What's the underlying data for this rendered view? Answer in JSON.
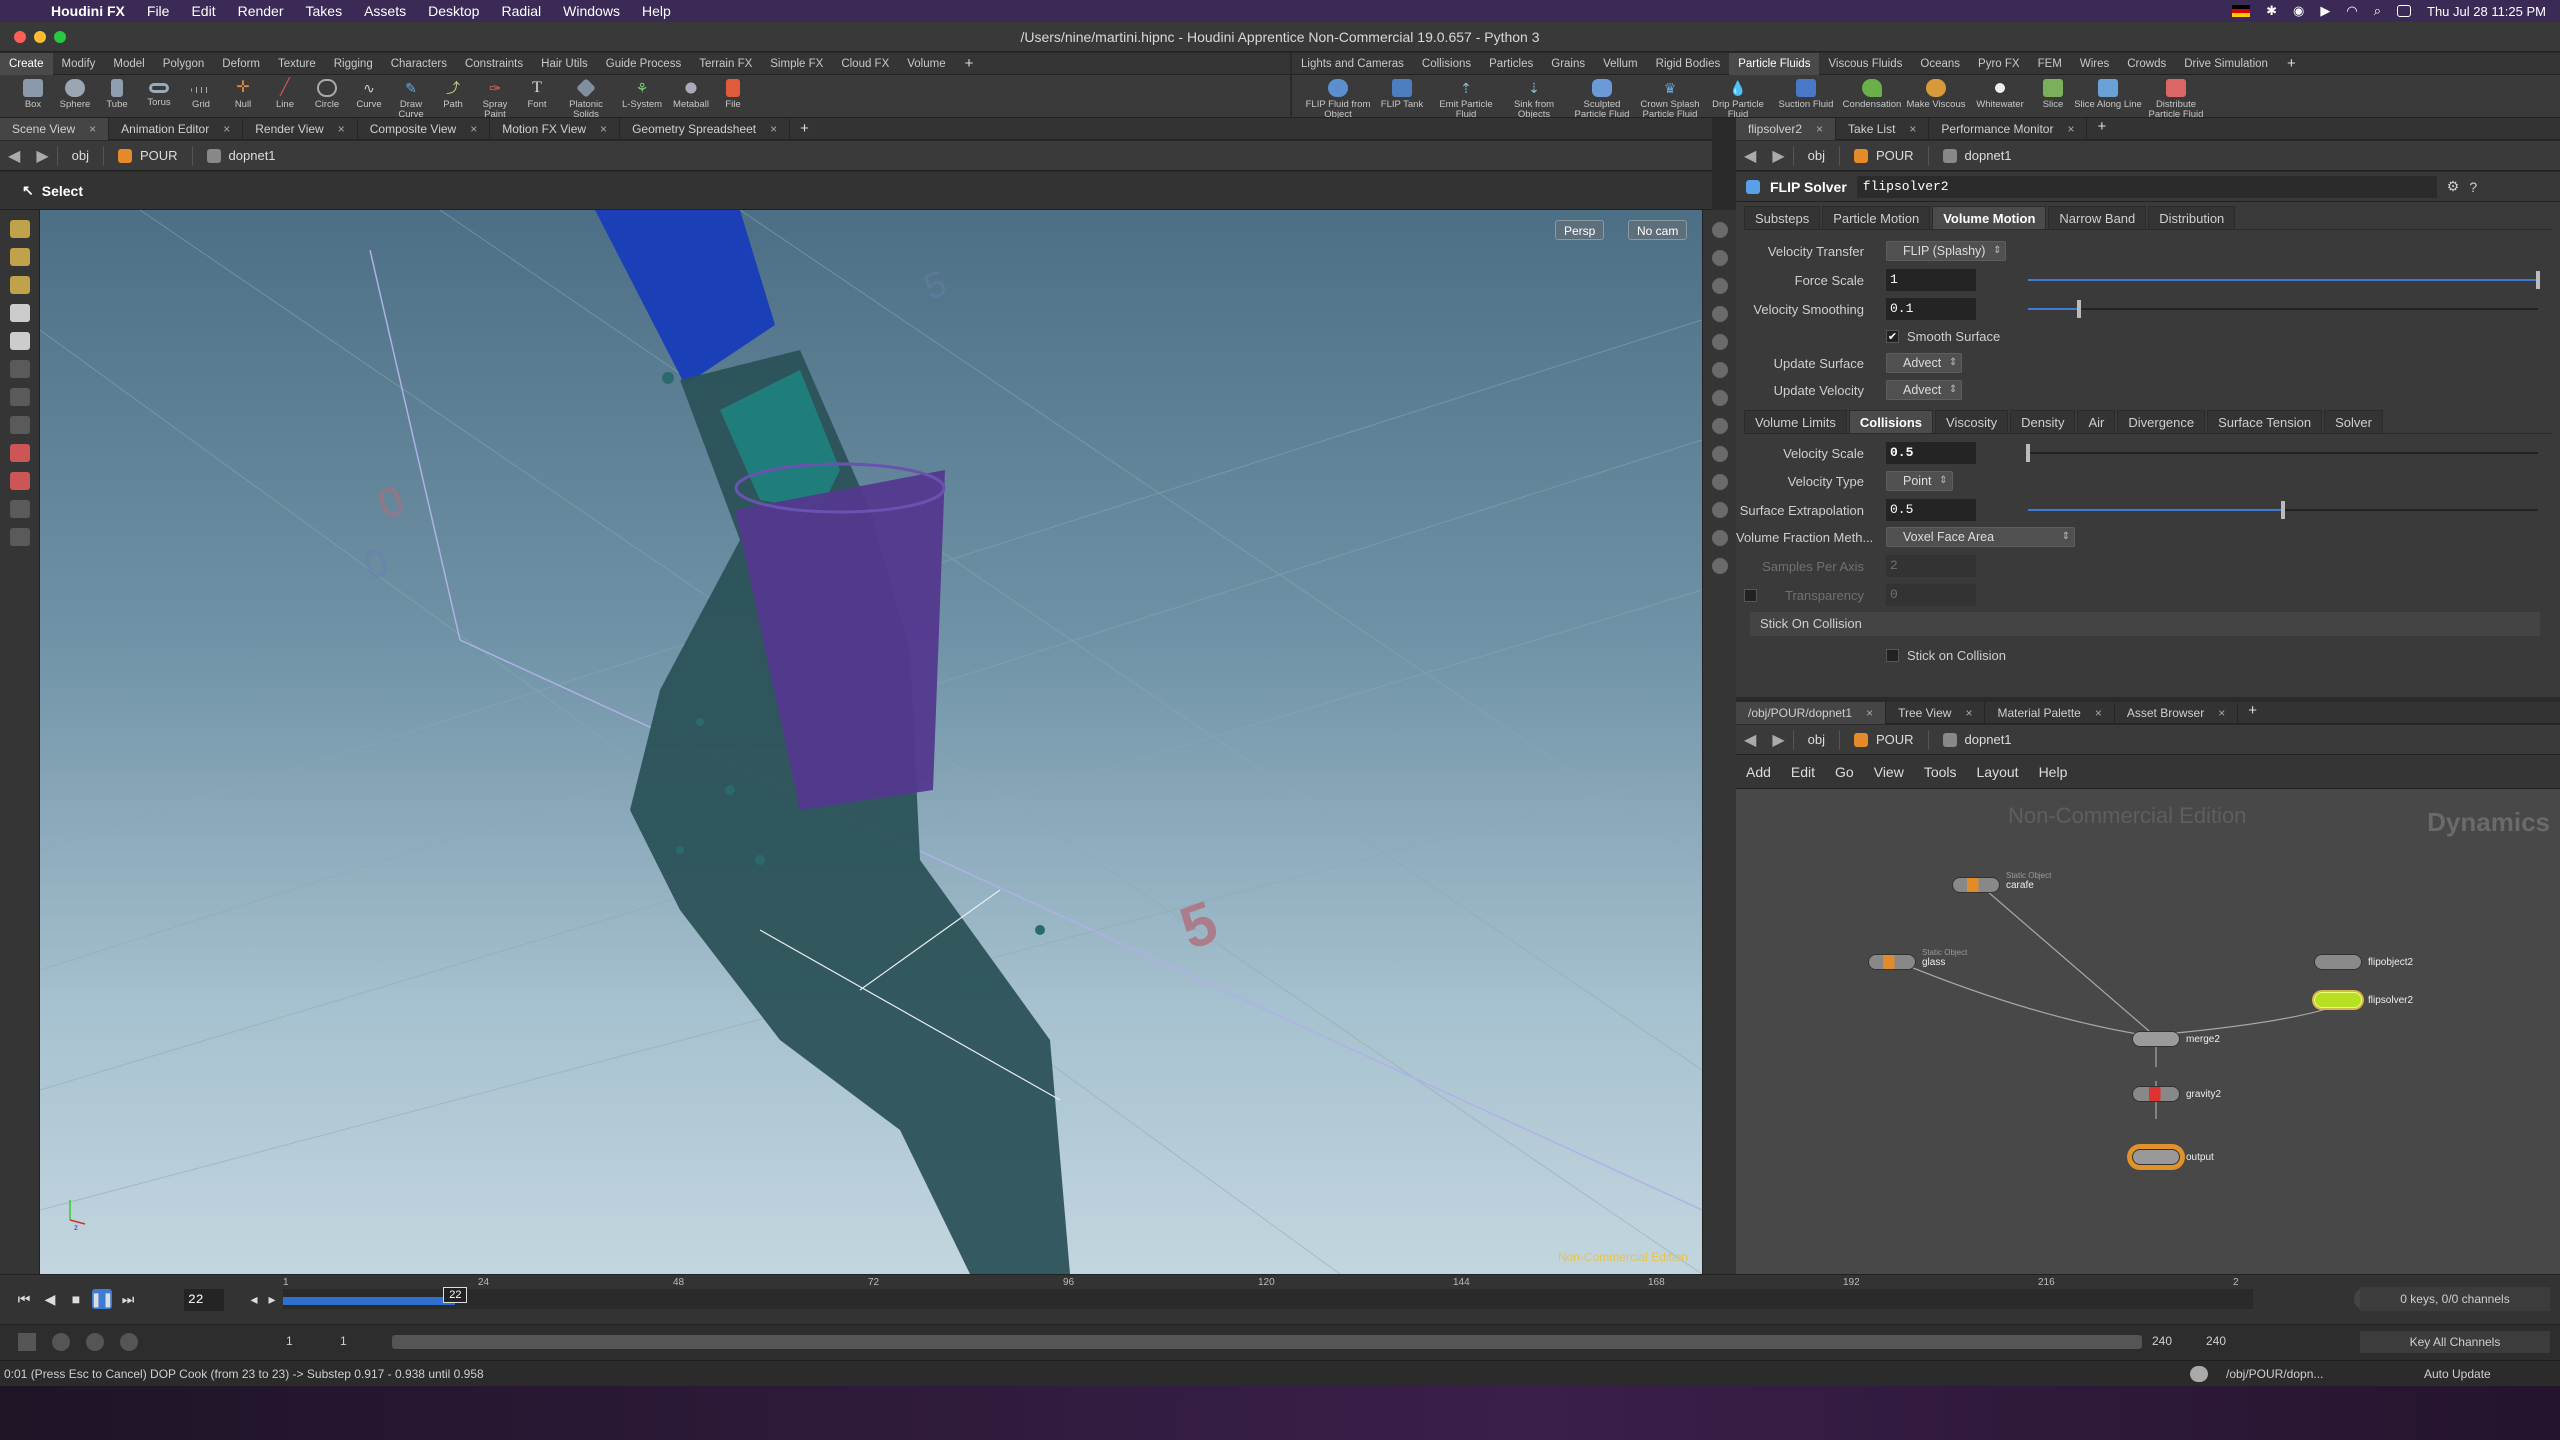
{
  "menubar": {
    "app": "Houdini FX",
    "items": [
      "File",
      "Edit",
      "Render",
      "Takes",
      "Assets",
      "Desktop",
      "Radial",
      "Windows",
      "Help"
    ],
    "clock": "Thu Jul 28  11:25 PM"
  },
  "window": {
    "title": "/Users/nine/martini.hipnc - Houdini Apprentice Non-Commercial 19.0.657 - Python 3"
  },
  "shelf_left": {
    "tabs": [
      "Create",
      "Modify",
      "Model",
      "Polygon",
      "Deform",
      "Texture",
      "Rigging",
      "Characters",
      "Constraints",
      "Hair Utils",
      "Guide Process",
      "Terrain FX",
      "Simple FX",
      "Cloud FX",
      "Volume"
    ],
    "tools": [
      "Box",
      "Sphere",
      "Tube",
      "Torus",
      "Grid",
      "Null",
      "Line",
      "Circle",
      "Curve",
      "Draw Curve",
      "Path",
      "Spray Paint",
      "Font",
      "Platonic Solids",
      "L-System",
      "Metaball",
      "File"
    ]
  },
  "shelf_right": {
    "tabs": [
      "Lights and Cameras",
      "Collisions",
      "Particles",
      "Grains",
      "Vellum",
      "Rigid Bodies",
      "Particle Fluids",
      "Viscous Fluids",
      "Oceans",
      "Pyro FX",
      "FEM",
      "Wires",
      "Crowds",
      "Drive Simulation"
    ],
    "tools": [
      "FLIP Fluid from Object",
      "FLIP Tank",
      "Emit Particle Fluid",
      "Sink from Objects",
      "Sculpted Particle Fluid",
      "Crown Splash Particle Fluid",
      "Drip Particle Fluid",
      "Suction Fluid",
      "Condensation",
      "Make Viscous",
      "Whitewater",
      "Slice",
      "Slice Along Line",
      "Distribute Particle Fluid"
    ]
  },
  "left_panel": {
    "tabs": [
      "Scene View",
      "Animation Editor",
      "Render View",
      "Composite View",
      "Motion FX View",
      "Geometry Spreadsheet"
    ],
    "path": [
      "obj",
      "POUR",
      "dopnet1"
    ],
    "mode": "Select",
    "persp": "Persp",
    "cam": "No cam",
    "watermark": "Non-Commercial Edition",
    "floor_labels": [
      "0",
      "5",
      "5"
    ]
  },
  "right_top": {
    "tabs": [
      "flipsolver2",
      "Take List",
      "Performance Monitor"
    ],
    "path": [
      "obj",
      "POUR",
      "dopnet1"
    ],
    "node_type": "FLIP Solver",
    "node_name": "flipsolver2",
    "tabs1": [
      "Substeps",
      "Particle Motion",
      "Volume Motion",
      "Narrow Band",
      "Distribution"
    ],
    "velocity_transfer": {
      "label": "Velocity Transfer",
      "value": "FLIP (Splashy)"
    },
    "force_scale": {
      "label": "Force Scale",
      "value": "1",
      "fraction": 1.0
    },
    "velocity_smoothing": {
      "label": "Velocity Smoothing",
      "value": "0.1",
      "fraction": 0.1
    },
    "smooth_surface": {
      "label": "Smooth Surface",
      "checked": "✔"
    },
    "update_surface": {
      "label": "Update Surface",
      "value": "Advect"
    },
    "update_velocity": {
      "label": "Update Velocity",
      "value": "Advect"
    },
    "tabs2": [
      "Volume Limits",
      "Collisions",
      "Viscosity",
      "Density",
      "Air",
      "Divergence",
      "Surface Tension",
      "Solver"
    ],
    "velocity_scale": {
      "label": "Velocity Scale",
      "value": "0.5",
      "fraction": 0.0
    },
    "velocity_type": {
      "label": "Velocity Type",
      "value": "Point"
    },
    "surface_extrapolation": {
      "label": "Surface Extrapolation",
      "value": "0.5",
      "fraction": 0.5
    },
    "volume_fraction": {
      "label": "Volume Fraction Meth...",
      "value": "Voxel Face Area"
    },
    "samples_per_axis": {
      "label": "Samples Per Axis",
      "value": "2"
    },
    "transparency": {
      "label": "Transparency",
      "value": "0"
    },
    "stick_folder": "Stick On Collision",
    "stick_on_collision": {
      "label": "Stick on Collision"
    }
  },
  "right_bottom": {
    "tabs": [
      "/obj/POUR/dopnet1",
      "Tree View",
      "Material Palette",
      "Asset Browser"
    ],
    "path": [
      "obj",
      "POUR",
      "dopnet1"
    ],
    "menu": [
      "Add",
      "Edit",
      "Go",
      "View",
      "Tools",
      "Layout",
      "Help"
    ],
    "watermark": "Non-Commercial Edition",
    "context": "Dynamics",
    "nodes": {
      "carafe": {
        "name": "carafe",
        "sub": "Static Object"
      },
      "glass": {
        "name": "glass",
        "sub": "Static Object"
      },
      "flipobject2": {
        "name": "flipobject2"
      },
      "flipsolver2": {
        "name": "flipsolver2"
      },
      "merge2": {
        "name": "merge2"
      },
      "gravity2": {
        "name": "gravity2"
      },
      "output": {
        "name": "output"
      }
    }
  },
  "timeline": {
    "frame": "22",
    "ticks": [
      "1",
      "24",
      "48",
      "72",
      "96",
      "120",
      "144",
      "168",
      "192",
      "216",
      "2"
    ],
    "marker": "22",
    "start": "1",
    "start2": "1",
    "end": "240",
    "end2": "240",
    "keys": "0 keys, 0/0 channels",
    "key_all": "Key All Channels",
    "progress": 0.0875
  },
  "status": {
    "text": "0:01 (Press Esc to Cancel) DOP Cook (from 23 to 23) -> Substep 0.917 - 0.938 until 0.958",
    "path": "/obj/POUR/dopn...",
    "update": "Auto Update"
  },
  "colors": {
    "accent": "#3e7bd4",
    "node_selected": "#b7e021",
    "menubar": "#3b2a56"
  }
}
